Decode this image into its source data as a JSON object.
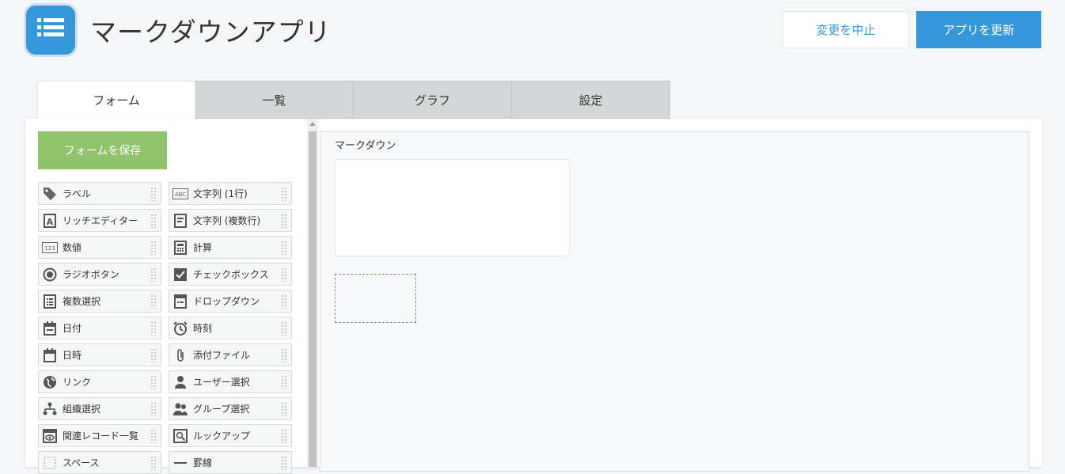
{
  "header": {
    "app_title": "マークダウンアプリ",
    "cancel_label": "変更を中止",
    "update_label": "アプリを更新",
    "accent_color": "#3498db"
  },
  "tabs": [
    {
      "label": "フォーム",
      "active": true
    },
    {
      "label": "一覧",
      "active": false
    },
    {
      "label": "グラフ",
      "active": false
    },
    {
      "label": "設定",
      "active": false
    }
  ],
  "palette": {
    "save_label": "フォームを保存",
    "save_color": "#91c36c",
    "fields": [
      {
        "label": "ラベル",
        "icon": "tag-icon"
      },
      {
        "label": "文字列 (1行)",
        "icon": "abc-icon"
      },
      {
        "label": "リッチエディター",
        "icon": "rich-text-icon"
      },
      {
        "label": "文字列 (複数行)",
        "icon": "multiline-icon"
      },
      {
        "label": "数値",
        "icon": "number-icon"
      },
      {
        "label": "計算",
        "icon": "calculator-icon"
      },
      {
        "label": "ラジオボタン",
        "icon": "radio-icon"
      },
      {
        "label": "チェックボックス",
        "icon": "checkbox-icon"
      },
      {
        "label": "複数選択",
        "icon": "multi-select-icon"
      },
      {
        "label": "ドロップダウン",
        "icon": "dropdown-icon"
      },
      {
        "label": "日付",
        "icon": "calendar-icon"
      },
      {
        "label": "時刻",
        "icon": "alarm-clock-icon"
      },
      {
        "label": "日時",
        "icon": "calendar-time-icon"
      },
      {
        "label": "添付ファイル",
        "icon": "paperclip-icon"
      },
      {
        "label": "リンク",
        "icon": "globe-icon"
      },
      {
        "label": "ユーザー選択",
        "icon": "user-icon"
      },
      {
        "label": "組織選択",
        "icon": "org-icon"
      },
      {
        "label": "グループ選択",
        "icon": "group-icon"
      },
      {
        "label": "関連レコード一覧",
        "icon": "related-records-icon"
      },
      {
        "label": "ルックアップ",
        "icon": "lookup-icon"
      },
      {
        "label": "スペース",
        "icon": "space-icon"
      },
      {
        "label": "罫線",
        "icon": "border-icon"
      }
    ]
  },
  "canvas": {
    "field_label": "マークダウン"
  }
}
